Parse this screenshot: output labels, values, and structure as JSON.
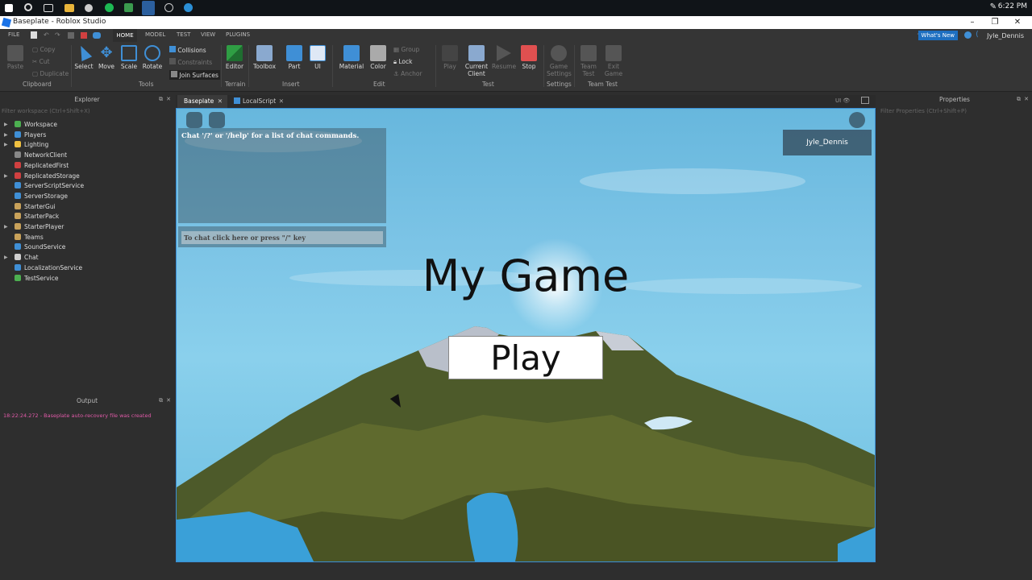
{
  "taskbar": {
    "clock": "6:22 PM"
  },
  "window": {
    "title": "Baseplate - Roblox Studio"
  },
  "menu": {
    "tabs": [
      "FILE",
      "HOME",
      "MODEL",
      "TEST",
      "VIEW",
      "PLUGINS"
    ],
    "whats_new": "What's New",
    "user": "Jyle_Dennis"
  },
  "ribbon": {
    "clipboard": {
      "paste": "Paste",
      "copy": "Copy",
      "cut": "Cut",
      "duplicate": "Duplicate",
      "label": "Clipboard"
    },
    "tools": {
      "select": "Select",
      "move": "Move",
      "scale": "Scale",
      "rotate": "Rotate",
      "collisions": "Collisions",
      "constraints": "Constraints",
      "join_surfaces": "Join Surfaces",
      "label": "Tools"
    },
    "terrain": {
      "editor": "Editor",
      "label": "Terrain"
    },
    "insert": {
      "toolbox": "Toolbox",
      "part": "Part",
      "ui": "UI",
      "label": "Insert"
    },
    "edit": {
      "material": "Material",
      "color": "Color",
      "group": "Group",
      "lock": "Lock",
      "anchor": "Anchor",
      "label": "Edit"
    },
    "test": {
      "play": "Play",
      "current_client": "Current Client",
      "resume": "Resume",
      "stop": "Stop",
      "label": "Test"
    },
    "settings": {
      "game_settings": "Game Settings",
      "label": "Settings"
    },
    "team_test": {
      "team_test": "Team Test",
      "exit_game": "Exit Game",
      "label": "Team Test"
    }
  },
  "explorer": {
    "title": "Explorer",
    "filter_placeholder": "Filter workspace (Ctrl+Shift+X)",
    "items": [
      {
        "label": "Workspace",
        "color": "#4caf50",
        "caret": true
      },
      {
        "label": "Players",
        "color": "#3f8fd6",
        "caret": true
      },
      {
        "label": "Lighting",
        "color": "#f0c040",
        "caret": true
      },
      {
        "label": "NetworkClient",
        "color": "#888888",
        "caret": false
      },
      {
        "label": "ReplicatedFirst",
        "color": "#d04040",
        "caret": false
      },
      {
        "label": "ReplicatedStorage",
        "color": "#d04040",
        "caret": true
      },
      {
        "label": "ServerScriptService",
        "color": "#3f8fd6",
        "caret": false
      },
      {
        "label": "ServerStorage",
        "color": "#3f8fd6",
        "caret": false
      },
      {
        "label": "StarterGui",
        "color": "#c9a25a",
        "caret": false
      },
      {
        "label": "StarterPack",
        "color": "#c9a25a",
        "caret": false
      },
      {
        "label": "StarterPlayer",
        "color": "#c9a25a",
        "caret": true
      },
      {
        "label": "Teams",
        "color": "#c9a25a",
        "caret": false
      },
      {
        "label": "SoundService",
        "color": "#3f8fd6",
        "caret": false
      },
      {
        "label": "Chat",
        "color": "#cfcfcf",
        "caret": true
      },
      {
        "label": "LocalizationService",
        "color": "#3f8fd6",
        "caret": false
      },
      {
        "label": "TestService",
        "color": "#4caf50",
        "caret": false
      }
    ]
  },
  "output": {
    "title": "Output",
    "lines": [
      "18:22:24.272 - Baseplate auto-recovery file was created"
    ]
  },
  "properties": {
    "title": "Properties",
    "filter_placeholder": "Filter Properties (Ctrl+Shift+P)"
  },
  "doc_tabs": [
    {
      "label": "Baseplate"
    },
    {
      "label": "LocalScript"
    }
  ],
  "viewport": {
    "chat_hint": "Chat '/?' or '/help' for a list of chat commands.",
    "chat_placeholder": "To chat click here or press \"/\" key",
    "player_name": "Jyle_Dennis",
    "game_title": "My Game",
    "play_label": "Play"
  }
}
